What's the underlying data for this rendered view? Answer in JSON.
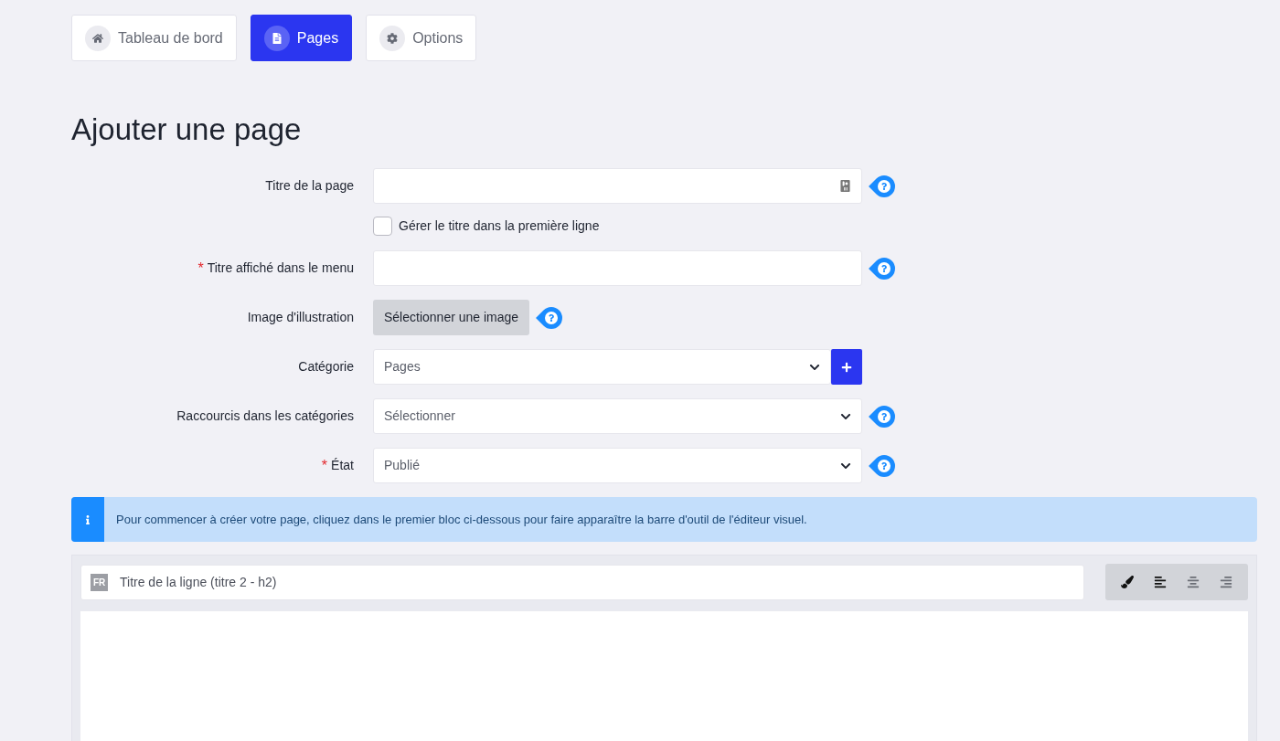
{
  "nav_tabs": [
    {
      "label": "Tableau de bord",
      "selected": false
    },
    {
      "label": "Pages",
      "selected": true
    },
    {
      "label": "Options",
      "selected": false
    }
  ],
  "heading": "Ajouter une page",
  "form_rows": [
    {
      "kind": "text",
      "label": "Titre de la page",
      "help": true,
      "contact_icon": true
    },
    {
      "kind": "checkbox",
      "text": "Gérer le titre dans la première ligne",
      "checked": false
    },
    {
      "kind": "text",
      "required_mark": "*",
      "label": "Titre affiché dans le menu",
      "help": true,
      "contact_icon": false
    },
    {
      "kind": "image",
      "label": "Image d'illustration",
      "button": "Sélectionner une image",
      "help": true
    },
    {
      "kind": "select",
      "label": "Catégorie",
      "value": "Pages",
      "help": false,
      "add_button": true
    },
    {
      "kind": "select",
      "label": "Raccourcis dans les catégories",
      "value": "Sélectionner",
      "help": true,
      "add_button": false
    },
    {
      "kind": "select",
      "required_mark": "*",
      "label": "État",
      "value": "Publié",
      "help": true,
      "add_button": false
    }
  ],
  "info_banner": "Pour commencer à créer votre page, cliquez dans le premier bloc ci-dessous pour faire apparaître la barre d'outil de l'éditeur visuel.",
  "editor": {
    "language": "FR",
    "title_placeholder": "Titre de la ligne (titre 2 - h2)",
    "toolbar": [
      {
        "selected": true
      },
      {
        "selected": true
      },
      {
        "selected": false
      },
      {
        "selected": false
      }
    ]
  }
}
